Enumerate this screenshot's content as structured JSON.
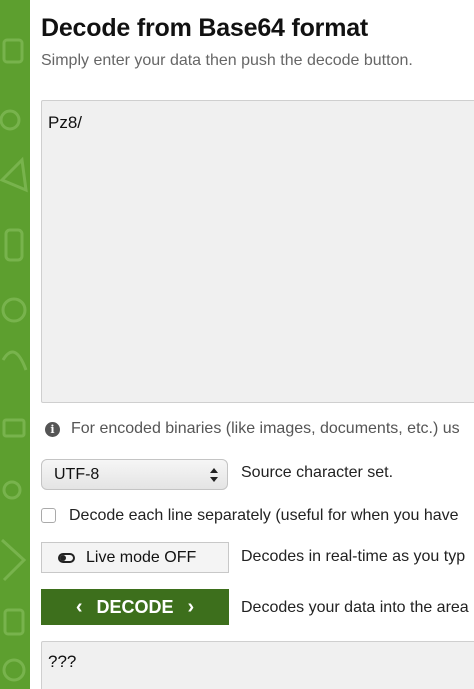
{
  "header": {
    "title": "Decode from Base64 format",
    "subtitle": "Simply enter your data then push the decode button."
  },
  "input": {
    "value": "Pz8/"
  },
  "info": {
    "icon": "info-icon",
    "text": "For encoded binaries (like images, documents, etc.) us"
  },
  "charset": {
    "selected": "UTF-8",
    "label": "Source character set."
  },
  "line_option": {
    "checked": false,
    "label": "Decode each line separately (useful for when you have"
  },
  "live_mode": {
    "button_label": "Live mode OFF",
    "description": "Decodes in real-time as you typ"
  },
  "decode": {
    "button_label": "DECODE",
    "description": "Decodes your data into the area"
  },
  "output": {
    "value": "???"
  },
  "colors": {
    "brand_green": "#5d9f2f",
    "button_green": "#3d6f1c"
  }
}
